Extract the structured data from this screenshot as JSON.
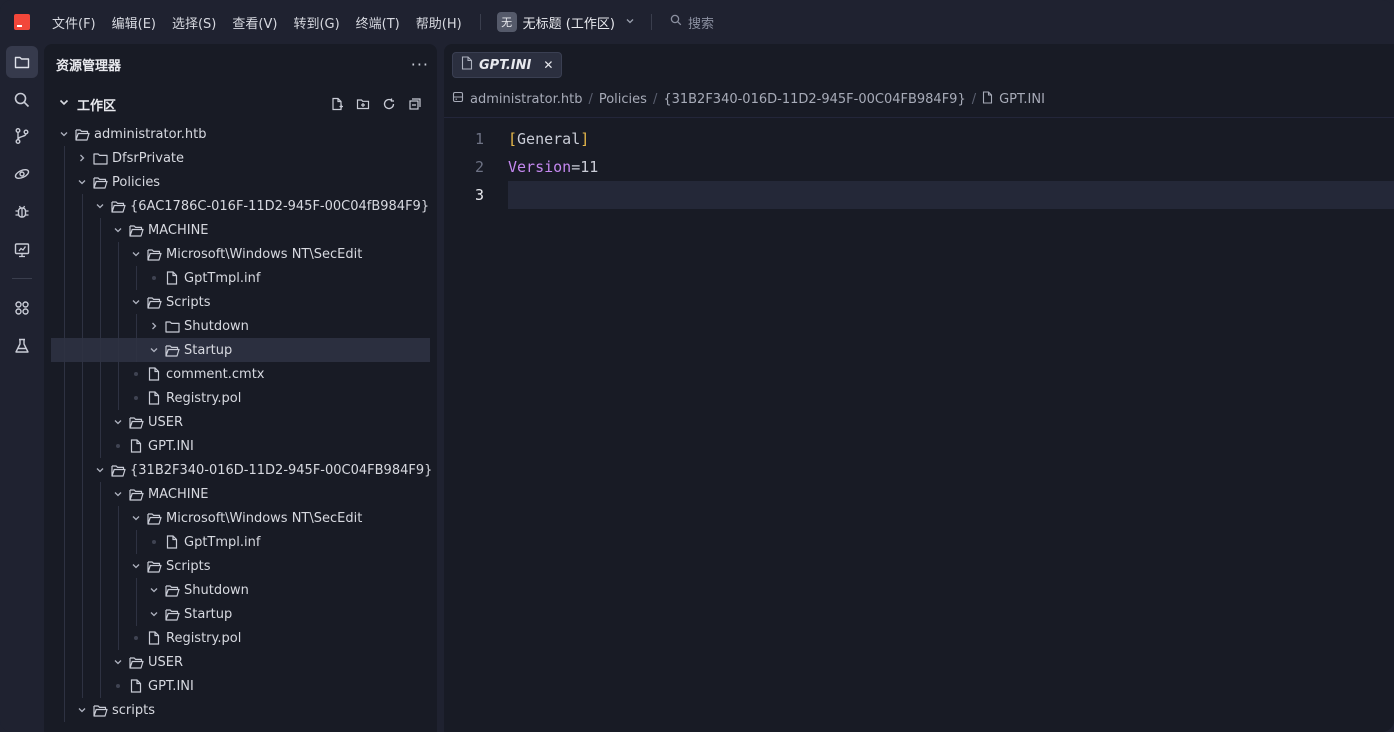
{
  "menu": [
    "文件(F)",
    "编辑(E)",
    "选择(S)",
    "查看(V)",
    "转到(G)",
    "终端(T)",
    "帮助(H)"
  ],
  "workspace": {
    "badge": "无",
    "title": "无标题 (工作区)"
  },
  "search": {
    "label": "搜索"
  },
  "activity": [
    "files-icon",
    "search-icon",
    "source-control-icon",
    "remote-icon",
    "debug-icon",
    "remote-explorer-icon",
    "extensions-icon",
    "testing-icon"
  ],
  "sidebar": {
    "title": "资源管理器",
    "more": "···",
    "workspace_label": "工作区"
  },
  "tree": [
    {
      "depth": 0,
      "type": "folder",
      "open": true,
      "name": "administrator.htb"
    },
    {
      "depth": 1,
      "type": "folder",
      "open": false,
      "name": "DfsrPrivate"
    },
    {
      "depth": 1,
      "type": "folder",
      "open": true,
      "name": "Policies"
    },
    {
      "depth": 2,
      "type": "folder",
      "open": true,
      "name": "{6AC1786C-016F-11D2-945F-00C04fB984F9}"
    },
    {
      "depth": 3,
      "type": "folder",
      "open": true,
      "name": "MACHINE"
    },
    {
      "depth": 4,
      "type": "folder",
      "open": true,
      "name": "Microsoft\\Windows NT\\SecEdit"
    },
    {
      "depth": 5,
      "type": "file",
      "name": "GptTmpl.inf"
    },
    {
      "depth": 4,
      "type": "folder",
      "open": true,
      "name": "Scripts"
    },
    {
      "depth": 5,
      "type": "folder",
      "open": false,
      "name": "Shutdown"
    },
    {
      "depth": 5,
      "type": "folder",
      "open": true,
      "name": "Startup",
      "selected": true
    },
    {
      "depth": 4,
      "type": "file",
      "name": "comment.cmtx"
    },
    {
      "depth": 4,
      "type": "file",
      "name": "Registry.pol"
    },
    {
      "depth": 3,
      "type": "folder",
      "open": true,
      "name": "USER"
    },
    {
      "depth": 3,
      "type": "file",
      "name": "GPT.INI"
    },
    {
      "depth": 2,
      "type": "folder",
      "open": true,
      "name": "{31B2F340-016D-11D2-945F-00C04FB984F9}"
    },
    {
      "depth": 3,
      "type": "folder",
      "open": true,
      "name": "MACHINE"
    },
    {
      "depth": 4,
      "type": "folder",
      "open": true,
      "name": "Microsoft\\Windows NT\\SecEdit"
    },
    {
      "depth": 5,
      "type": "file",
      "name": "GptTmpl.inf"
    },
    {
      "depth": 4,
      "type": "folder",
      "open": true,
      "name": "Scripts"
    },
    {
      "depth": 5,
      "type": "folder",
      "open": true,
      "name": "Shutdown"
    },
    {
      "depth": 5,
      "type": "folder",
      "open": true,
      "name": "Startup"
    },
    {
      "depth": 4,
      "type": "file",
      "name": "Registry.pol"
    },
    {
      "depth": 3,
      "type": "folder",
      "open": true,
      "name": "USER"
    },
    {
      "depth": 3,
      "type": "file",
      "name": "GPT.INI"
    },
    {
      "depth": 1,
      "type": "folder",
      "open": true,
      "name": "scripts"
    }
  ],
  "editor": {
    "tab": {
      "name": "GPT.INI",
      "close": "✕"
    },
    "breadcrumb": [
      "administrator.htb",
      "Policies",
      "{31B2F340-016D-11D2-945F-00C04FB984F9}",
      "GPT.INI"
    ],
    "lines": [
      {
        "no": "1",
        "open": "[",
        "section": "General",
        "close": "]"
      },
      {
        "no": "2",
        "key": "Version",
        "eq": "=",
        "val": "11"
      },
      {
        "no": "3"
      }
    ]
  },
  "colors": {
    "accent_logo": "#f2473a",
    "bracket": "#e8b94a",
    "key": "#c488f0",
    "selection": "#2b2f3f"
  }
}
